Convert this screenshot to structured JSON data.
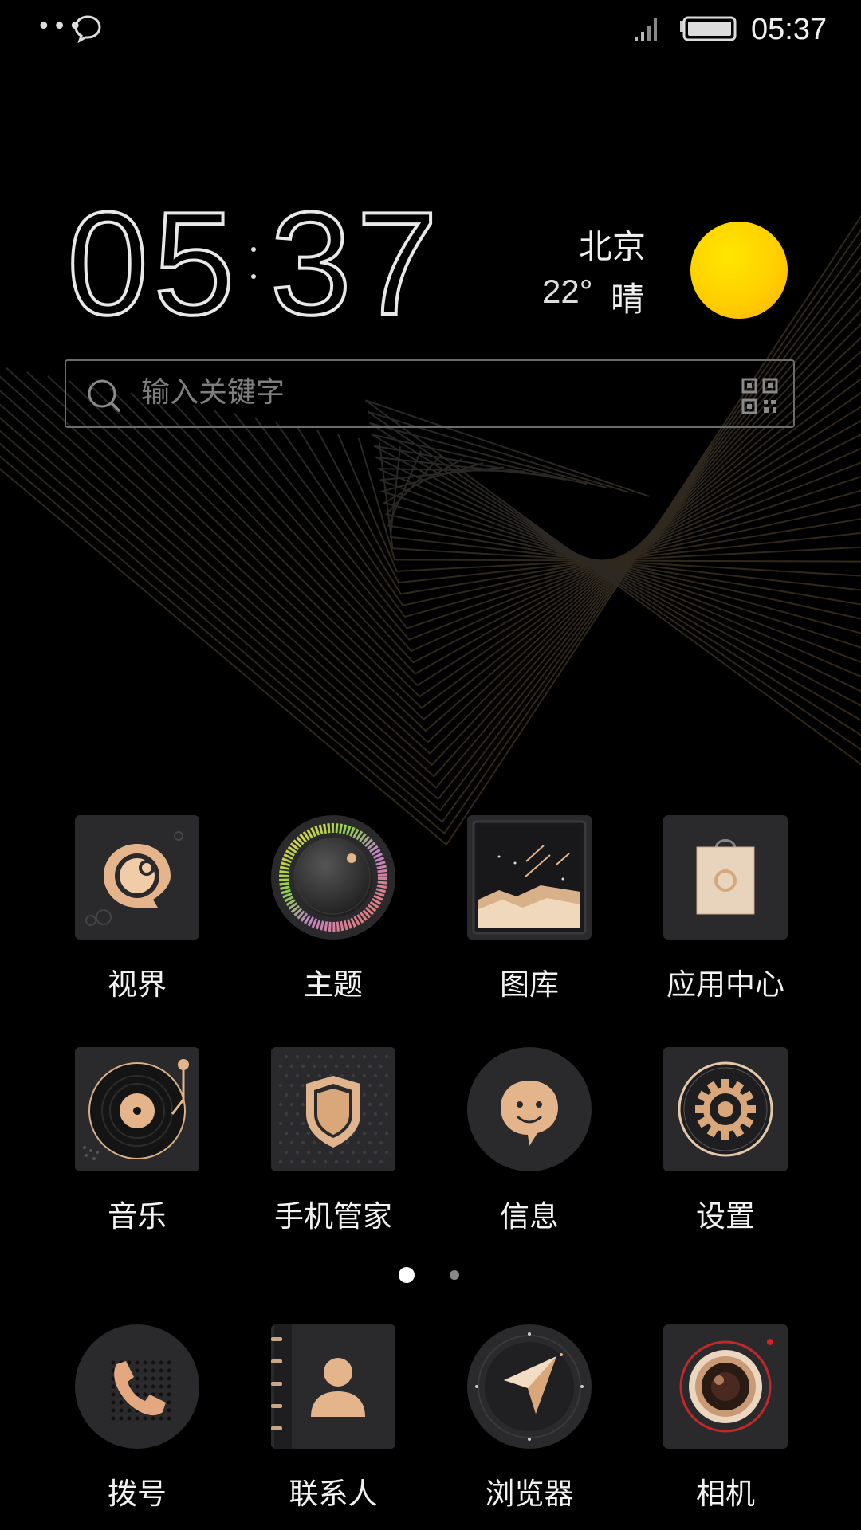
{
  "status_bar": {
    "more_icon": "more-dots-icon",
    "notification_icon": "chat-bubble-icon",
    "signal_icon": "signal-icon",
    "battery_icon": "battery-icon",
    "time": "05:37"
  },
  "clock": {
    "hours": "05",
    "minutes": "37"
  },
  "weather": {
    "city": "北京",
    "temperature": "22°",
    "condition": "晴",
    "icon": "sun-icon",
    "sun_color": "#ffcc00"
  },
  "search": {
    "placeholder": "输入关键字",
    "search_icon": "search-icon",
    "scan_icon": "qr-code-icon"
  },
  "apps": [
    {
      "label": "视界",
      "icon": "video-eye-icon"
    },
    {
      "label": "主题",
      "icon": "theme-dial-icon"
    },
    {
      "label": "图库",
      "icon": "gallery-icon"
    },
    {
      "label": "应用中心",
      "icon": "app-store-bag-icon"
    },
    {
      "label": "音乐",
      "icon": "record-player-icon"
    },
    {
      "label": "手机管家",
      "icon": "shield-icon"
    },
    {
      "label": "信息",
      "icon": "message-smile-icon"
    },
    {
      "label": "设置",
      "icon": "settings-gear-icon"
    }
  ],
  "page_indicator": {
    "pages": 2,
    "current": 1
  },
  "dock": [
    {
      "label": "拨号",
      "icon": "phone-icon"
    },
    {
      "label": "联系人",
      "icon": "contacts-icon"
    },
    {
      "label": "浏览器",
      "icon": "compass-icon"
    },
    {
      "label": "相机",
      "icon": "camera-lens-icon"
    }
  ],
  "colors": {
    "background": "#000000",
    "accent_gold": "#d9a77a",
    "tile_dark": "#2a2a2d"
  }
}
